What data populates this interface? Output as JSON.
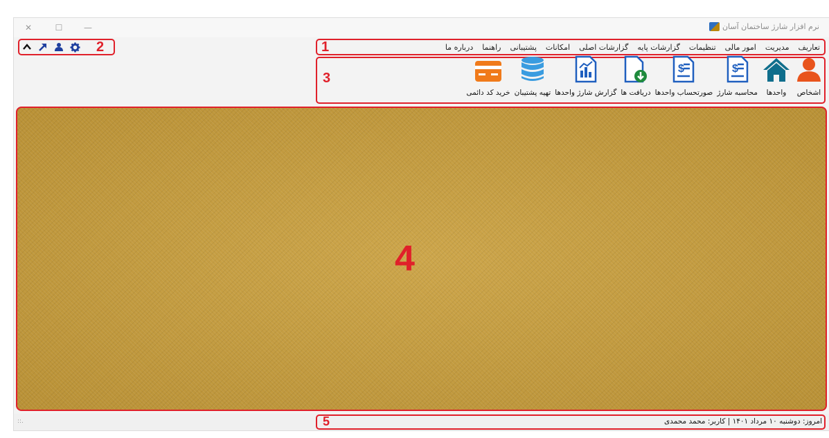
{
  "window": {
    "title": "نرم افزار شارژ ساختمان آسان",
    "controls": {
      "close": "✕",
      "maximize": "☐",
      "minimize": "—"
    }
  },
  "callouts": {
    "menu": "1",
    "quick_tools": "2",
    "ribbon": "3",
    "workspace": "4",
    "status": "5"
  },
  "menu": {
    "items": [
      "تعاریف",
      "مدیریت",
      "امور مالی",
      "تنظیمات",
      "گزارشات پایه",
      "گزارشات اصلی",
      "امکانات",
      "پشتیبانی",
      "راهنما",
      "درباره ما"
    ]
  },
  "quick_tools": {
    "icons": [
      "chevron-up-icon",
      "arrow-up-right-icon",
      "user-icon",
      "gear-icon"
    ]
  },
  "ribbon": {
    "buttons": [
      {
        "label": "اشخاص",
        "icon": "person-icon"
      },
      {
        "label": "واحدها",
        "icon": "home-icon"
      },
      {
        "label": "محاسبه شارژ",
        "icon": "invoice-icon"
      },
      {
        "label": "صورتحساب واحدها",
        "icon": "statement-icon"
      },
      {
        "label": "دریافت ها",
        "icon": "download-document-icon"
      },
      {
        "label": "گزارش شارژ واحدها",
        "icon": "report-chart-icon"
      },
      {
        "label": "تهیه پشتیبان",
        "icon": "database-icon"
      },
      {
        "label": "خرید کد دائمی",
        "icon": "credit-card-icon"
      }
    ]
  },
  "status": {
    "text": "امروز: دوشنبه ۱۰ مرداد ۱۴۰۱  |  کاربر: محمد محمدی",
    "grip": "::."
  },
  "colors": {
    "callout": "#e0202a",
    "accent_blue": "#1f5fbf",
    "workspace": "#c29a3c"
  }
}
